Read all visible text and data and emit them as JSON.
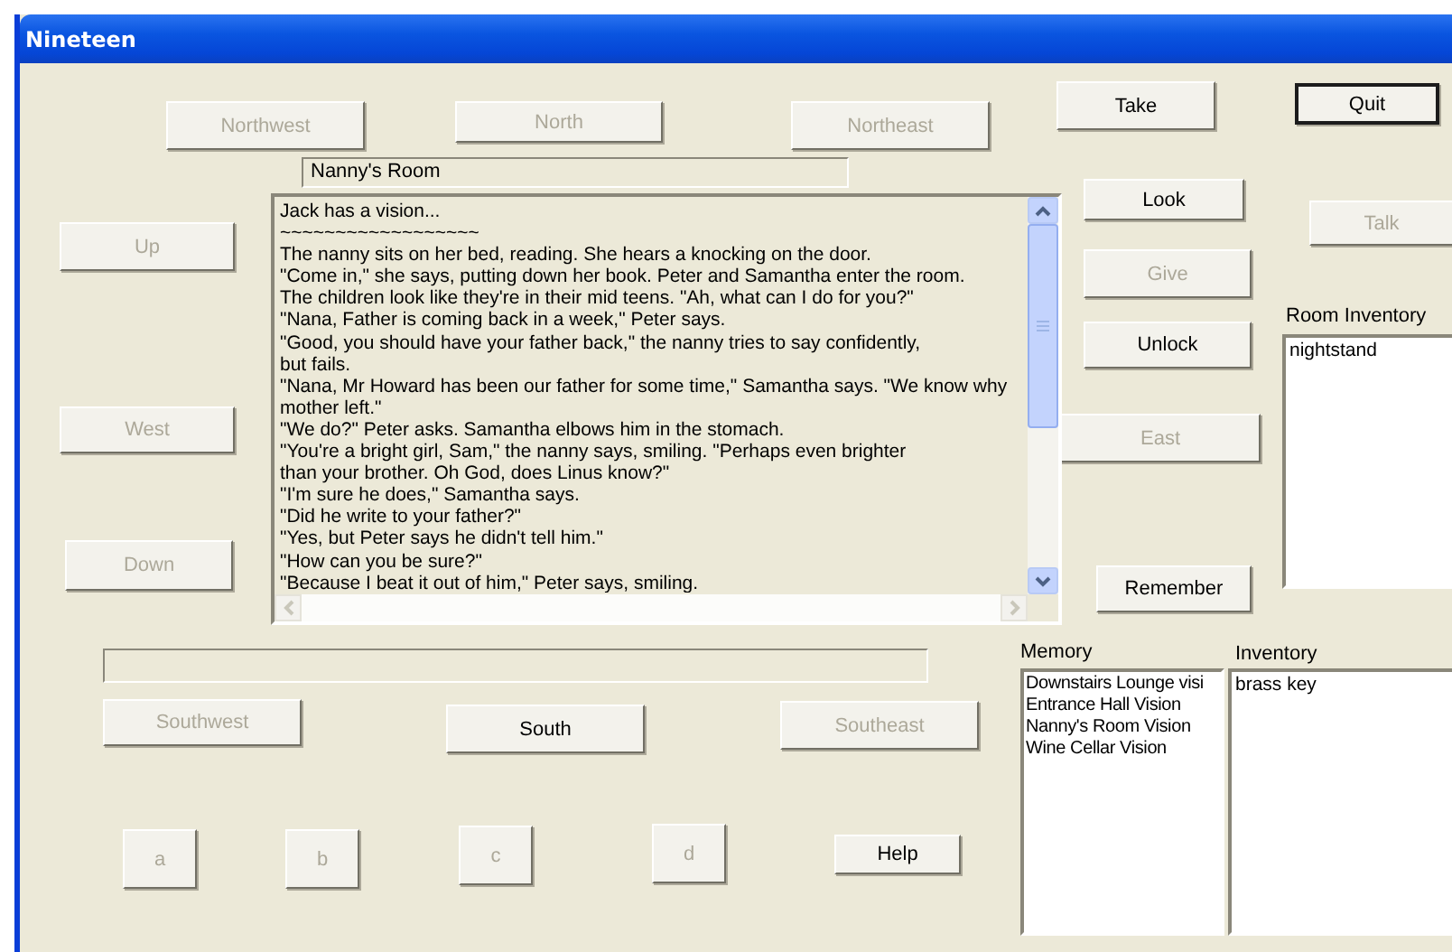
{
  "window": {
    "title": "Nineteen"
  },
  "navigation": {
    "northwest": {
      "label": "Northwest",
      "disabled": true
    },
    "north": {
      "label": "North",
      "disabled": true
    },
    "northeast": {
      "label": "Northeast",
      "disabled": true
    },
    "up": {
      "label": "Up",
      "disabled": true
    },
    "west": {
      "label": "West",
      "disabled": true
    },
    "east": {
      "label": "East",
      "disabled": true
    },
    "down": {
      "label": "Down",
      "disabled": true
    },
    "southwest": {
      "label": "Southwest",
      "disabled": true
    },
    "south": {
      "label": "South",
      "disabled": false
    },
    "southeast": {
      "label": "Southeast",
      "disabled": true
    }
  },
  "actions": {
    "take": {
      "label": "Take",
      "disabled": false,
      "default": false
    },
    "quit": {
      "label": "Quit",
      "disabled": false,
      "default": true
    },
    "look": {
      "label": "Look",
      "disabled": false,
      "default": false
    },
    "talk": {
      "label": "Talk",
      "disabled": true,
      "default": false
    },
    "give": {
      "label": "Give",
      "disabled": true,
      "default": false
    },
    "unlock": {
      "label": "Unlock",
      "disabled": false,
      "default": false
    },
    "remember": {
      "label": "Remember",
      "disabled": false,
      "default": false
    },
    "help": {
      "label": "Help",
      "disabled": false,
      "default": false
    }
  },
  "option_buttons": [
    {
      "label": "a",
      "disabled": true
    },
    {
      "label": "b",
      "disabled": true
    },
    {
      "label": "c",
      "disabled": true
    },
    {
      "label": "d",
      "disabled": true
    }
  ],
  "room_name_field": {
    "value": "Nanny's Room"
  },
  "story": {
    "lines": [
      "Jack has a vision...",
      "~~~~~~~~~~~~~~~~~~",
      "The nanny sits on her bed, reading. She hears a knocking on the door.",
      "\"Come in,\" she says, putting down her book. Peter and Samantha enter the room.",
      "The children look like they're in their mid teens. \"Ah, what can I do for you?\"",
      "\"Nana, Father is coming back in a week,\" Peter says.",
      "\"Good, you should have your father back,\" the nanny tries to say confidently,",
      "but fails.",
      "\"Nana, Mr Howard has been our father for some time,\" Samantha says. \"We know why",
      "mother left.\"",
      "\"We do?\" Peter asks. Samantha elbows him in the stomach.",
      "\"You're a bright girl, Sam,\" the nanny says, smiling. \"Perhaps even brighter",
      "than your brother. Oh God, does Linus know?\"",
      "\"I'm sure he does,\" Samantha says.",
      "\"Did he write to your father?\"",
      "\"Yes, but Peter says he didn't tell him.\"",
      "\"How can you be sure?\"",
      "\"Because I beat it out of him,\" Peter says, smiling."
    ]
  },
  "room_inventory": {
    "label": "Room Inventory",
    "items": [
      "nightstand"
    ]
  },
  "memory": {
    "label": "Memory",
    "items": [
      "Downstairs Lounge visi",
      "Entrance Hall Vision",
      "Nanny's Room Vision",
      "Wine Cellar Vision"
    ]
  },
  "inventory": {
    "label": "Inventory",
    "items": [
      "brass key"
    ]
  }
}
